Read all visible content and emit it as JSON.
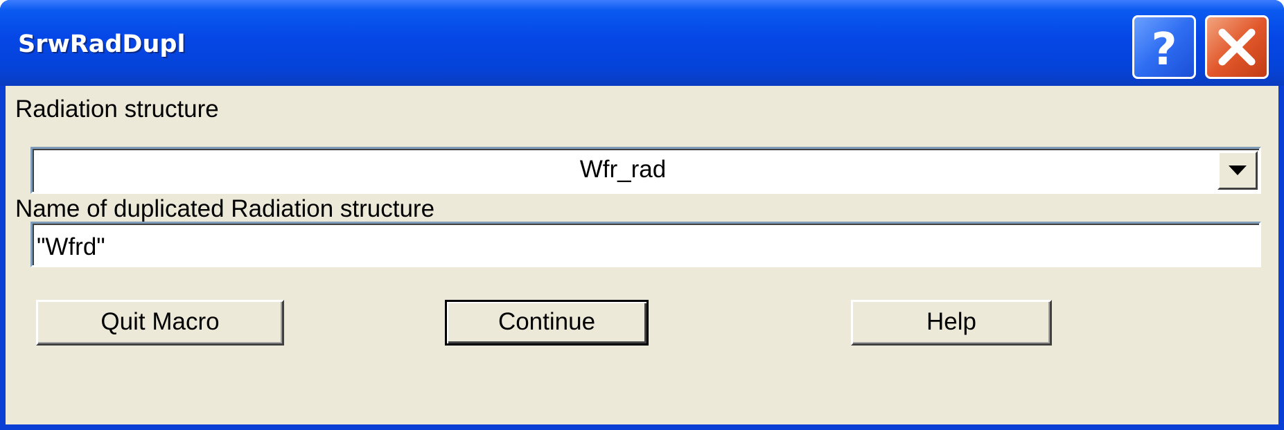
{
  "window": {
    "title": "SrwRadDupl"
  },
  "caption_buttons": {
    "help_icon": "question-mark-icon",
    "close_icon": "close-x-icon"
  },
  "form": {
    "radiation_label": "Radiation structure",
    "radiation_selected": "Wfr_rad",
    "duplicate_label": "Name of duplicated Radiation structure",
    "duplicate_value": "\"Wfrd\""
  },
  "buttons": {
    "quit_label": "Quit Macro",
    "continue_label": "Continue",
    "help_label": "Help"
  },
  "colors": {
    "titlebar": "#0546e6",
    "dialog_face": "#ece9d8",
    "close_button": "#e2582c",
    "help_button": "#2e6df2"
  }
}
